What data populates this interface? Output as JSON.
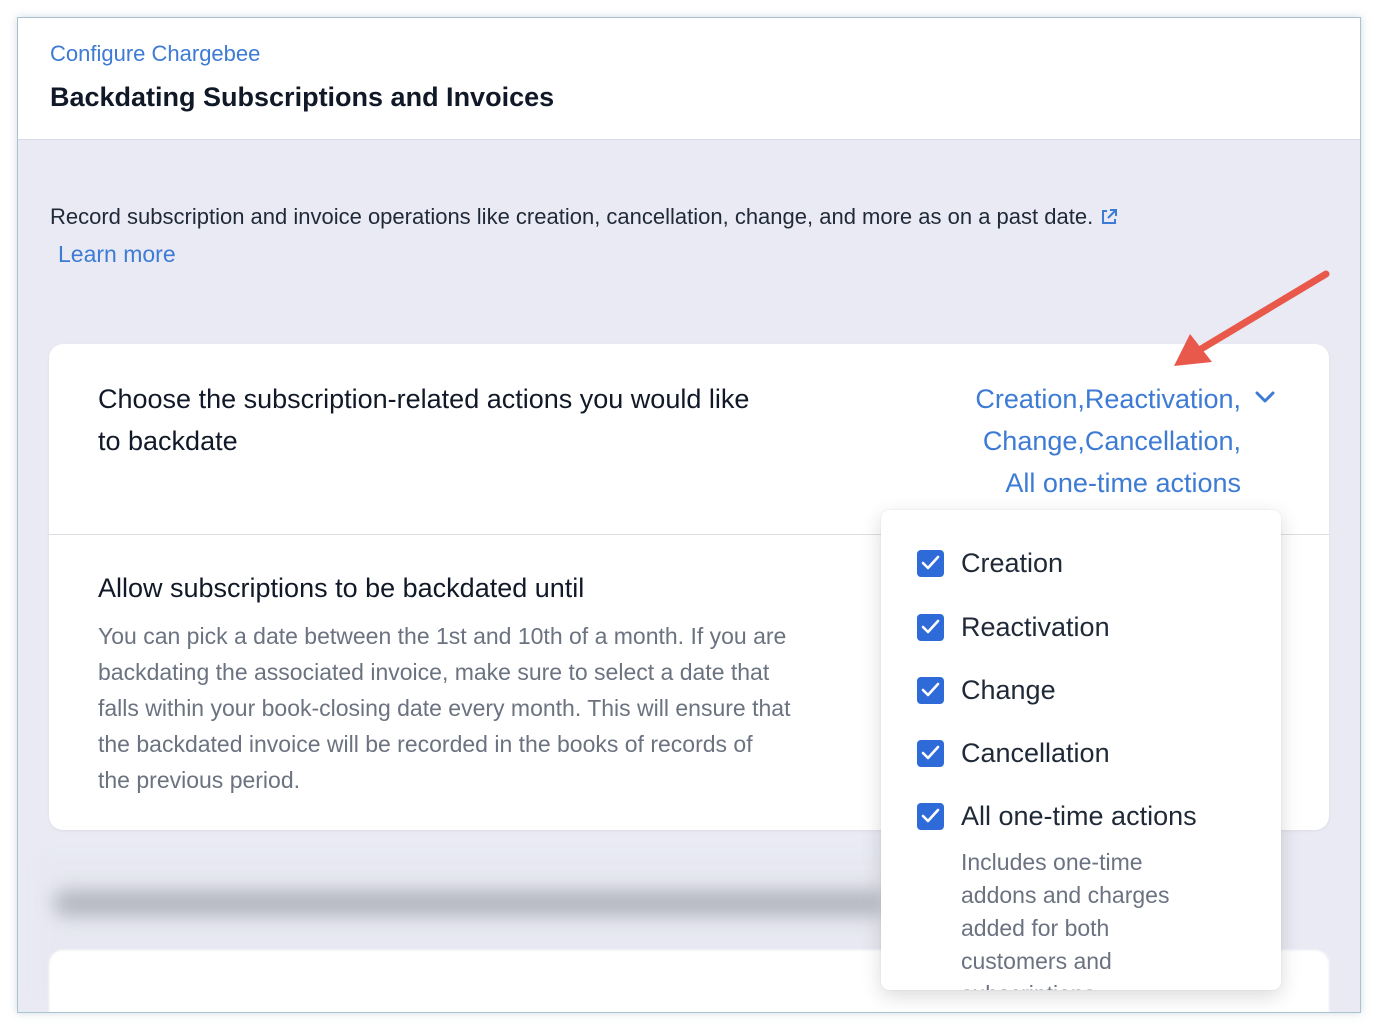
{
  "header": {
    "breadcrumb": "Configure Chargebee",
    "title": "Backdating Subscriptions and Invoices"
  },
  "description": {
    "text": "Record subscription and invoice operations like creation, cancellation, change, and more as on a past date.",
    "link_icon": "external-link-icon",
    "learn_more": "Learn more"
  },
  "subscription_actions": {
    "label_line1": "Choose the subscription-related actions you would like",
    "label_line2": "to backdate",
    "selected_line1": "Creation,Reactivation,",
    "selected_line2": "Change,Cancellation,",
    "selected_line3": "All one-time actions",
    "dropdown_icon": "chevron-down-icon"
  },
  "backdate_until": {
    "title": "Allow subscriptions to be backdated until",
    "help_lines": [
      "You can pick a date between the 1st and 10th of a month. If you are",
      "backdating the associated invoice, make sure to select a date that",
      "falls within your book-closing date every month. This will ensure that",
      "the backdated invoice will be recorded in the books of records of",
      "the previous period."
    ]
  },
  "dropdown": {
    "options": [
      {
        "label": "Creation",
        "checked": true
      },
      {
        "label": "Reactivation",
        "checked": true
      },
      {
        "label": "Change",
        "checked": true
      },
      {
        "label": "Cancellation",
        "checked": true
      },
      {
        "label": "All one-time actions",
        "checked": true
      }
    ],
    "one_time_help_lines": [
      "Includes one-time",
      "addons and charges",
      "added for both",
      "customers and",
      "subscriptions"
    ]
  },
  "colors": {
    "accent": "#3d7bd4",
    "checkbox": "#2f6ad9",
    "background": "#e9eaf4",
    "annotation_arrow": "#e8584b"
  }
}
